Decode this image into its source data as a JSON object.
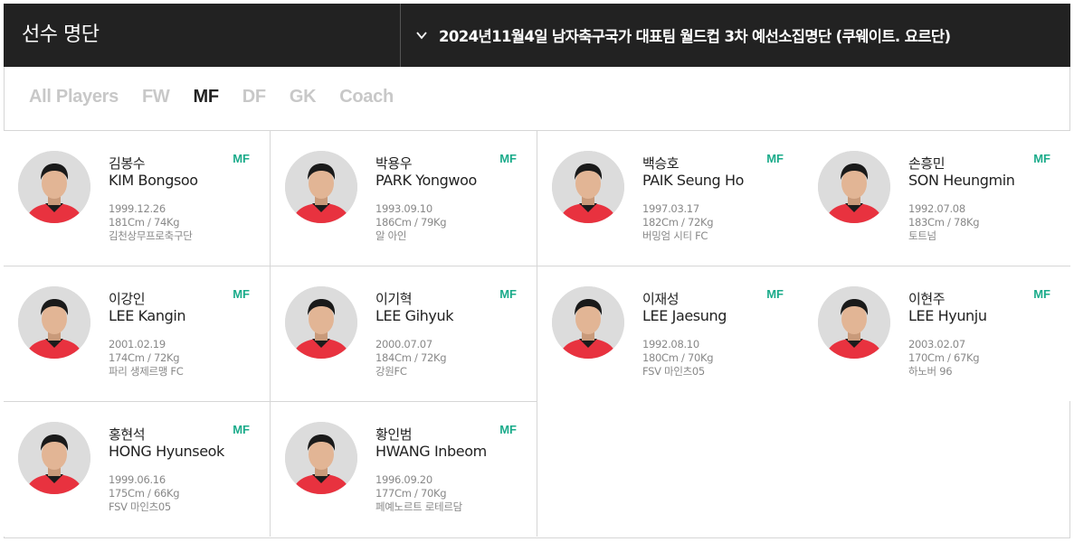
{
  "header": {
    "title": "선수 명단",
    "squad_select": "2024년11월4일 남자축구국가 대표팀 월드컵 3차 예선소집명단 (쿠웨이트. 요르단)",
    "squad_select_icon": "chevron-down-icon"
  },
  "filters": [
    "All Players",
    "FW",
    "MF",
    "DF",
    "GK",
    "Coach"
  ],
  "active_filter": "MF",
  "colors": {
    "header_bg": "#222222",
    "accent_position": "#1aab8a",
    "tab_inactive": "#c8c8c8",
    "kit_red": "#e8323f"
  },
  "players": [
    {
      "name_kr": "김봉수",
      "name_en": "KIM Bongsoo",
      "position": "MF",
      "birth": "1999.12.26",
      "body": "181Cm / 74Kg",
      "club": "김천상무프로축구단"
    },
    {
      "name_kr": "박용우",
      "name_en": "PARK Yongwoo",
      "position": "MF",
      "birth": "1993.09.10",
      "body": "186Cm / 79Kg",
      "club": "알 아인"
    },
    {
      "name_kr": "백승호",
      "name_en": "PAIK Seung Ho",
      "position": "MF",
      "birth": "1997.03.17",
      "body": "182Cm / 72Kg",
      "club": "버밍엄 시티 FC"
    },
    {
      "name_kr": "손흥민",
      "name_en": "SON Heungmin",
      "position": "MF",
      "birth": "1992.07.08",
      "body": "183Cm / 78Kg",
      "club": "토트넘"
    },
    {
      "name_kr": "이강인",
      "name_en": "LEE Kangin",
      "position": "MF",
      "birth": "2001.02.19",
      "body": "174Cm / 72Kg",
      "club": "파리 생제르맹 FC"
    },
    {
      "name_kr": "이기혁",
      "name_en": "LEE Gihyuk",
      "position": "MF",
      "birth": "2000.07.07",
      "body": "184Cm / 72Kg",
      "club": "강원FC"
    },
    {
      "name_kr": "이재성",
      "name_en": "LEE Jaesung",
      "position": "MF",
      "birth": "1992.08.10",
      "body": "180Cm / 70Kg",
      "club": "FSV 마인츠05"
    },
    {
      "name_kr": "이현주",
      "name_en": "LEE Hyunju",
      "position": "MF",
      "birth": "2003.02.07",
      "body": "170Cm / 67Kg",
      "club": "하노버 96"
    },
    {
      "name_kr": "홍현석",
      "name_en": "HONG Hyunseok",
      "position": "MF",
      "birth": "1999.06.16",
      "body": "175Cm / 66Kg",
      "club": "FSV 마인츠05"
    },
    {
      "name_kr": "황인범",
      "name_en": "HWANG Inbeom",
      "position": "MF",
      "birth": "1996.09.20",
      "body": "177Cm / 70Kg",
      "club": "페예노르트 로테르담"
    }
  ]
}
